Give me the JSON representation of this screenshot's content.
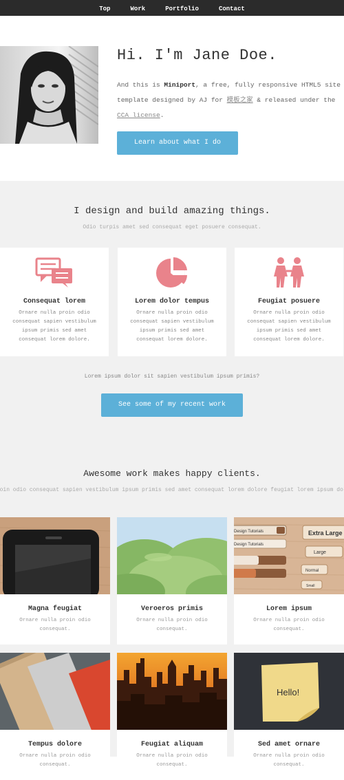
{
  "nav": {
    "items": [
      "Top",
      "Work",
      "Portfolio",
      "Contact"
    ]
  },
  "intro": {
    "title": "Hi. I'm Jane Doe.",
    "text_prefix": "And this is ",
    "text_brand": "Miniport",
    "text_middle": ", a free, fully responsive HTML5 site template designed by AJ for ",
    "text_link1": "模板之家",
    "text_after": " & released under the ",
    "text_link2": "CCA license",
    "text_end": ".",
    "button": "Learn about what I do"
  },
  "features": {
    "title": "I design and build amazing things.",
    "subtitle": "Odio turpis amet sed consequat eget posuere consequat.",
    "cards": [
      {
        "icon": "chat-bubbles-icon",
        "title": "Consequat lorem",
        "text": "Ornare nulla proin odio consequat sapien vestibulum ipsum primis sed amet consequat lorem dolore."
      },
      {
        "icon": "pie-chart-icon",
        "title": "Lorem dolor tempus",
        "text": "Ornare nulla proin odio consequat sapien vestibulum ipsum primis sed amet consequat lorem dolore."
      },
      {
        "icon": "people-icon",
        "title": "Feugiat posuere",
        "text": "Ornare nulla proin odio consequat sapien vestibulum ipsum primis sed amet consequat lorem dolore."
      }
    ],
    "note": "Lorem ipsum dolor sit sapien vestibulum ipsum primis?",
    "button": "See some of my recent work"
  },
  "portfolio": {
    "title": "Awesome work makes happy clients.",
    "subtitle": "Proin odio consequat sapien vestibulum ipsum primis sed amet consequat lorem dolore feugiat lorem ipsum dolore.",
    "items": [
      {
        "title": "Magna feugiat",
        "text": "Ornare nulla proin odio consequat."
      },
      {
        "title": "Veroeros primis",
        "text": "Ornare nulla proin odio consequat."
      },
      {
        "title": "Lorem ipsum",
        "text": "Ornare nulla proin odio consequat."
      },
      {
        "title": "Tempus dolore",
        "text": "Ornare nulla proin odio consequat."
      },
      {
        "title": "Feugiat aliquam",
        "text": "Ornare nulla proin odio consequat."
      },
      {
        "title": "Sed amet ornare",
        "text": "Ornare nulla proin odio consequat."
      }
    ],
    "thumb3": {
      "dropdown1": "Design Tutorials",
      "dropdown2": "Design Tutorials",
      "btn_xl": "Extra Large",
      "btn_l": "Large",
      "btn_n": "Normal",
      "btn_s": "Small"
    },
    "thumb6": {
      "note": "Hello!"
    }
  },
  "colors": {
    "nav_bg": "#2b2b2b",
    "accent_blue": "#5cb0d8",
    "icon_pink": "#e9838b",
    "section_bg": "#f1f1f1"
  }
}
